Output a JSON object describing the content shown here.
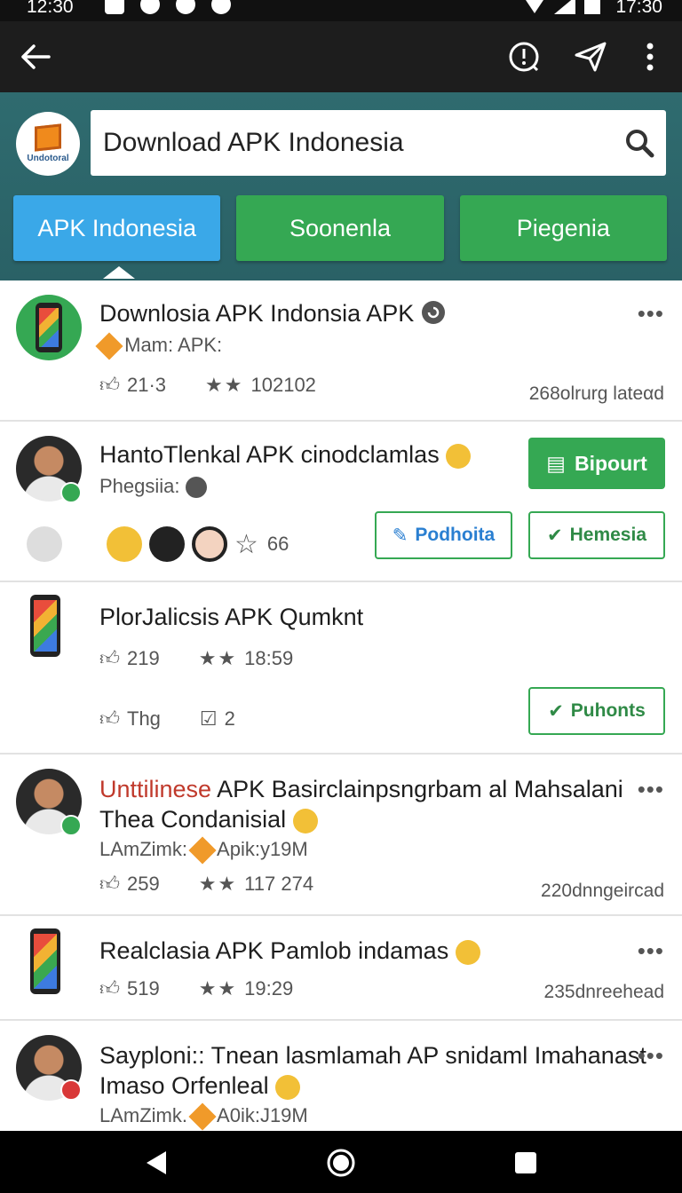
{
  "status": {
    "time_left": "12:30",
    "time_right": "17:30"
  },
  "appbar": {
    "back_icon": "arrow-left-icon",
    "info_icon": "info-icon",
    "send_icon": "send-icon",
    "more_icon": "more-vert-icon"
  },
  "header": {
    "logo_text": "Undotoral",
    "search_value": "Download APK Indonesia",
    "tabs": [
      {
        "label": "APK Indonesia"
      },
      {
        "label": "Soonenla"
      },
      {
        "label": "Piegenia"
      }
    ]
  },
  "items": [
    {
      "title": "Downlosia APK Indonsia APK",
      "sub": "Mam: APK:",
      "likes": "21·3",
      "rating": "102102",
      "right": "268olrurg lateαd"
    },
    {
      "title": "HantoTlenkal APK cinodclamlas",
      "sub": "Phegsiia:",
      "count": "66",
      "primary_btn": "Bipourt",
      "btn_a": "Podhoita",
      "btn_b": "Hemesia"
    },
    {
      "title": "PlorJalicsis APK Qumknt",
      "likes": "219",
      "rating": "18:59",
      "tag": "Thg",
      "tag_count": "2",
      "btn": "Puhonts"
    },
    {
      "title_red": "Unttilinese",
      "title": "APK Basirclainpsngrbam al Mahsalani",
      "title2": "Thea Condanisial",
      "sub": "LAmZimk:",
      "sub2": "Apik:y19M",
      "likes": "259",
      "rating": "117 274",
      "right": "220dnngeircad"
    },
    {
      "title": "Realclasia APK Pamlob indamas",
      "likes": "519",
      "rating": "19:29",
      "right": "235dnreehead"
    },
    {
      "title": "Sayploni:: Tnean lasmlamah AP snidaml Imahanast",
      "title2": "Imaso Orfenleal",
      "sub": "LAmZimk.",
      "sub2": "A0ik:J19M"
    }
  ],
  "colors": {
    "green": "#35a853",
    "blue": "#3aa8e8",
    "header": "#2f6b6f"
  }
}
